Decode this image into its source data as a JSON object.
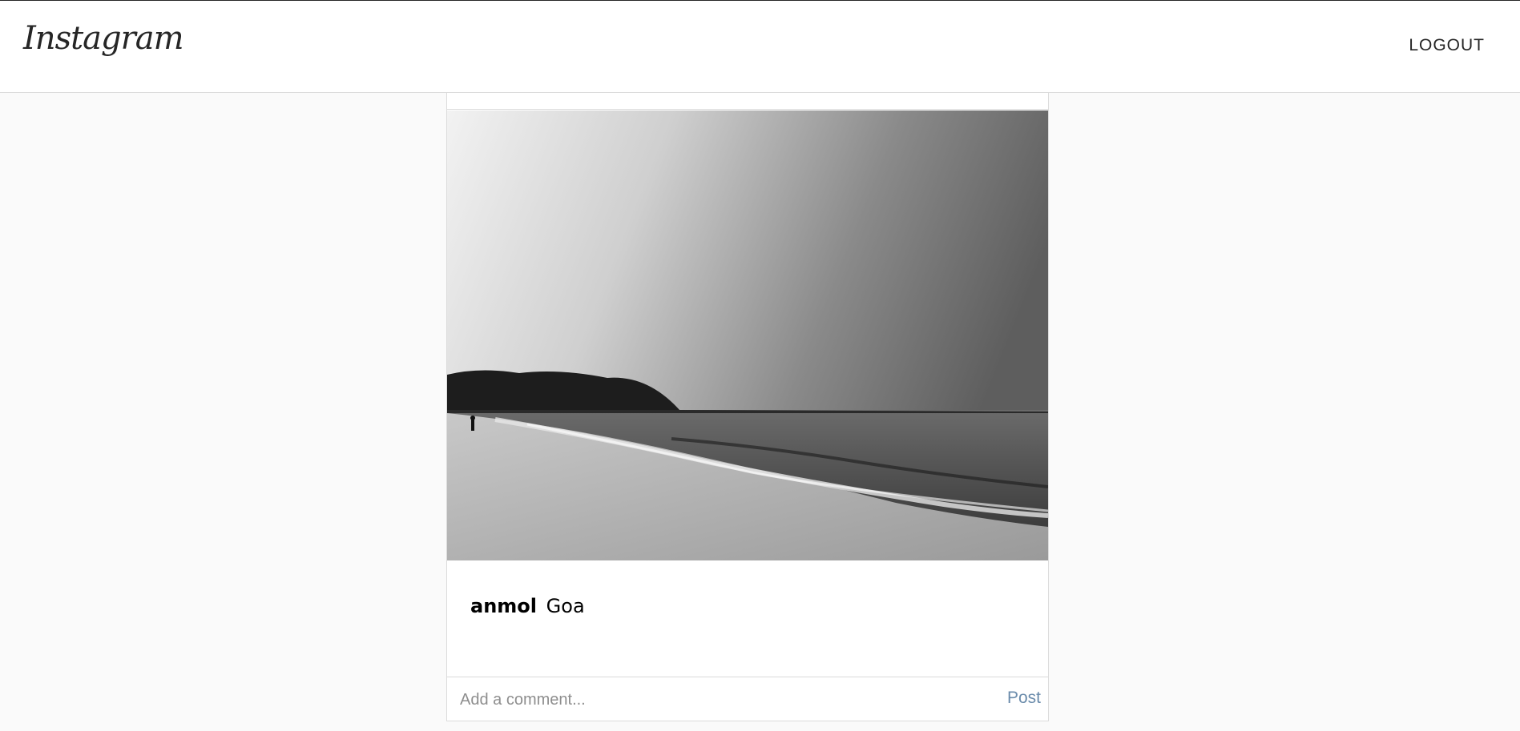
{
  "header": {
    "logo_text": "Instagram",
    "logout_label": "LOGOUT"
  },
  "post": {
    "image_description_icon": "beach-photo",
    "caption_user": "anmol",
    "caption_text": "Goa",
    "comment_placeholder": "Add a comment...",
    "comment_value": "",
    "post_label": "Post"
  },
  "colors": {
    "background": "#fafafa",
    "border": "#dbdbdb",
    "post_button": "#6a8bab"
  }
}
